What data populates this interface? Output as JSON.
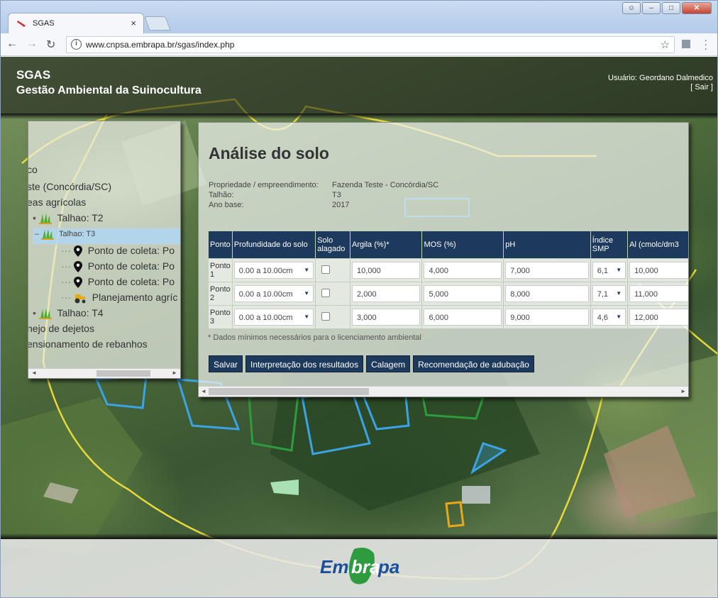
{
  "browser": {
    "tab_title": "SGAS",
    "tab_close": "×",
    "url": "www.cnpsa.embrapa.br/sgas/index.php",
    "window_buttons": [
      "–",
      "□",
      "✕"
    ]
  },
  "header": {
    "title": "SGAS",
    "subtitle": "Gestão Ambiental da Suinocultura",
    "user": "Usuário: Geordano Dalmedico",
    "logout": "[ Sair ]"
  },
  "tree": {
    "nodes": [
      {
        "label": "co"
      },
      {
        "label": "ste (Concórdia/SC)"
      },
      {
        "label": "eas agrícolas"
      },
      {
        "label": "Talhao: T2",
        "icon": "crop-icon"
      },
      {
        "label": "Talhao: T3",
        "icon": "crop-icon",
        "selected": true
      },
      {
        "label": "Ponto de coleta: Po",
        "icon": "map-pin-icon"
      },
      {
        "label": "Ponto de coleta: Po",
        "icon": "map-pin-icon"
      },
      {
        "label": "Ponto de coleta: Po",
        "icon": "map-pin-icon"
      },
      {
        "label": "Planejamento agríc",
        "icon": "tractor-icon"
      },
      {
        "label": "Talhao: T4",
        "icon": "crop-icon"
      },
      {
        "label": "nejo de dejetos"
      },
      {
        "label": "ensionamento de rebanhos"
      }
    ]
  },
  "main": {
    "heading": "Análise do solo",
    "info": [
      {
        "label": "Propriedade / empreendimento:",
        "value": "Fazenda Teste - Concórdia/SC"
      },
      {
        "label": "Talhão:",
        "value": "T3"
      },
      {
        "label": "Ano base:",
        "value": "2017"
      }
    ],
    "table": {
      "headers": [
        "Ponto",
        "Profundidade do solo",
        "Solo alagado",
        "Argila (%)*",
        "MOS (%)",
        "pH",
        "Índice SMP",
        "Al (cmolc/dm3"
      ],
      "rows": [
        {
          "ponto": "Ponto 1",
          "profundidade": "0.00 a 10.00cm",
          "argila": "10,000",
          "mos": "4,000",
          "ph": "7,000",
          "smp": "6,1",
          "al": "10,000"
        },
        {
          "ponto": "Ponto 2",
          "profundidade": "0.00 a 10.00cm",
          "argila": "2,000",
          "mos": "5,000",
          "ph": "8,000",
          "smp": "7,1",
          "al": "11,000"
        },
        {
          "ponto": "Ponto 3",
          "profundidade": "0.00 a 10.00cm",
          "argila": "3,000",
          "mos": "6,000",
          "ph": "9,000",
          "smp": "4,6",
          "al": "12,000"
        }
      ]
    },
    "footnote": "* Dados mínimos necessários para o licenciamento ambiental",
    "buttons": {
      "save": "Salvar",
      "interpret": "Interpretação dos resultados",
      "liming": "Calagem",
      "fertilization": "Recomendação de adubação"
    }
  },
  "footer": {
    "logo_text": "Embrapa"
  },
  "colors": {
    "header_bg": "#1d3a5c",
    "logo_green": "#2e9b3e",
    "logo_blue": "#1b4f9c",
    "map_yellow": "#e8d83a",
    "map_blue": "#3aa4e6"
  }
}
